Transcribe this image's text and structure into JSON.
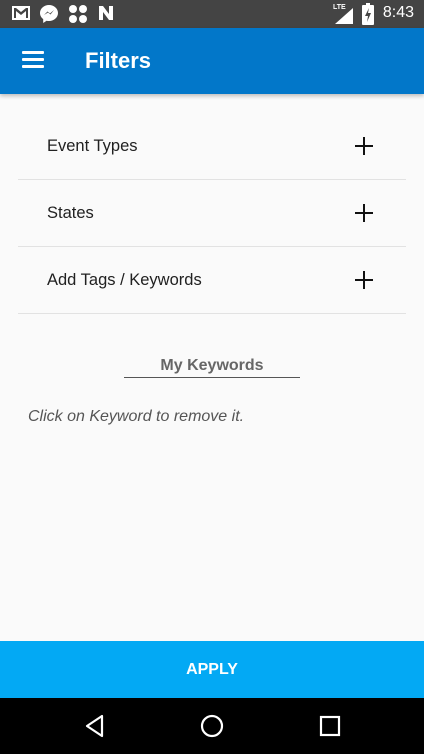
{
  "status_bar": {
    "time": "8:43",
    "network": "LTE",
    "icons": [
      "gmail-icon",
      "messenger-icon",
      "grid-app-icon",
      "n-app-icon",
      "signal-icon",
      "battery-charging-icon"
    ]
  },
  "app_bar": {
    "title": "Filters",
    "menu_icon": "hamburger-menu-icon",
    "color": "#0277c9"
  },
  "filters": [
    {
      "label": "Event Types",
      "icon": "plus-icon"
    },
    {
      "label": "States",
      "icon": "plus-icon"
    },
    {
      "label": "Add Tags / Keywords",
      "icon": "plus-icon"
    }
  ],
  "keywords": {
    "title": "My Keywords",
    "hint": "Click on Keyword to remove it."
  },
  "apply": {
    "label": "APPLY",
    "color": "#03a9f4"
  },
  "nav_bar": {
    "icons": [
      "back-icon",
      "home-icon",
      "recents-icon"
    ]
  }
}
